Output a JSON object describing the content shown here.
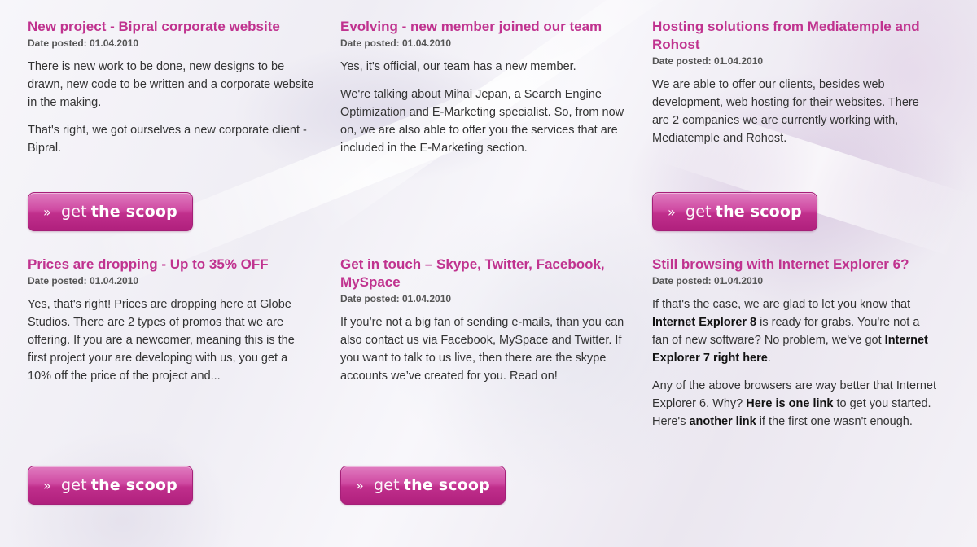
{
  "posts": [
    {
      "title": "New project - Bipral corporate website",
      "date": "Date posted: 01.04.2010",
      "paragraphs": [
        [
          {
            "t": "There is new work to be done, new designs to be drawn, new code to be written and a corporate website in the making.",
            "b": false
          }
        ],
        [
          {
            "t": "That's right, we got ourselves a new corporate client - Bipral.",
            "b": false
          }
        ]
      ],
      "button": {
        "chevron": "»",
        "light": "get",
        "bold": "the scoop"
      }
    },
    {
      "title": "Evolving - new member joined our team",
      "date": "Date posted: 01.04.2010",
      "paragraphs": [
        [
          {
            "t": "Yes, it's official, our team has a new member.",
            "b": false
          }
        ],
        [
          {
            "t": "We're talking about Mihai Jepan, a Search Engine Optimization and E-Marketing specialist. So, from now on, we are also able to offer you the services that are included in the E-Marketing section.",
            "b": false
          }
        ]
      ],
      "button": null
    },
    {
      "title": "Hosting solutions from Mediatemple and Rohost",
      "date": "Date posted: 01.04.2010",
      "paragraphs": [
        [
          {
            "t": "We are able to offer our clients, besides web development, web hosting for their websites. There are 2 companies we are currently working with, Mediatemple and Rohost.",
            "b": false
          }
        ]
      ],
      "button": {
        "chevron": "»",
        "light": "get",
        "bold": "the scoop"
      }
    },
    {
      "title": "Prices are dropping - Up to 35% OFF",
      "date": "Date posted: 01.04.2010",
      "paragraphs": [
        [
          {
            "t": "Yes, that's right! Prices are dropping here at Globe Studios. There are 2 types of promos that we are offering. If you are a newcomer, meaning this is the first project your are developing with us, you get a 10% off the price of the project and...",
            "b": false
          }
        ]
      ],
      "button": {
        "chevron": "»",
        "light": "get",
        "bold": "the scoop"
      }
    },
    {
      "title": "Get in touch – Skype, Twitter, Facebook, MySpace",
      "date": "Date posted: 01.04.2010",
      "paragraphs": [
        [
          {
            "t": "If you’re not a big fan of sending e-mails, than you can also contact us via Facebook, MySpace and Twitter. If you want to talk to us live, then there are the skype accounts we’ve created for you. Read on!",
            "b": false
          }
        ]
      ],
      "button": {
        "chevron": "»",
        "light": "get",
        "bold": "the scoop"
      }
    },
    {
      "title": "Still browsing with Internet Explorer 6?",
      "date": "Date posted: 01.04.2010",
      "paragraphs": [
        [
          {
            "t": "If that's the case, we are glad to let you know that ",
            "b": false
          },
          {
            "t": "Internet Explorer 8",
            "b": true
          },
          {
            "t": " is ready for grabs. You're not a fan of new software? No problem, we've got ",
            "b": false
          },
          {
            "t": "Internet Explorer 7 right here",
            "b": true
          },
          {
            "t": ".",
            "b": false
          }
        ],
        [
          {
            "t": "Any of the above browsers are way better that Internet Explorer 6. Why? ",
            "b": false
          },
          {
            "t": "Here is one link",
            "b": true
          },
          {
            "t": " to get you started. Here's ",
            "b": false
          },
          {
            "t": "another link",
            "b": true
          },
          {
            "t": " if the first one wasn't enough.",
            "b": false
          }
        ]
      ],
      "button": null
    }
  ]
}
